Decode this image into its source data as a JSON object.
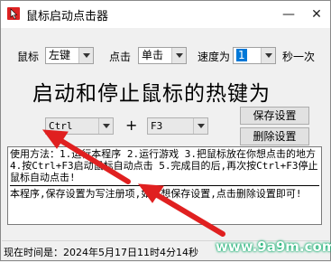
{
  "window": {
    "title": "鼠标启动点击器",
    "min_label": "—",
    "close_label": "✕"
  },
  "mouse_row": {
    "mouse_label": "鼠标",
    "button_value": "左键",
    "click_label": "点击",
    "click_mode_value": "单击",
    "speed_label": "速度为",
    "speed_value": "1",
    "unit_label": "秒一次"
  },
  "headline": "启动和停止鼠标的热键为",
  "hotkey": {
    "modifier_value": "Ctrl",
    "plus": "+",
    "key_value": "F3"
  },
  "buttons": {
    "save": "保存设置",
    "delete": "删除设置"
  },
  "instructions": {
    "p1": "使用方法：1.运行本程序 2.运行游戏 3.把鼠标放在你想点击的地方 4.按Ctrl+F3启动鼠标自动点击 5.完成目的后,再次按Ctrl+F3停止鼠标自动点击!",
    "p2": "本程序,保存设置为写注册项,如不想保存设置,点击删除设置即可!"
  },
  "status": "现在时间是：2024年5月17日11时4分14秒",
  "watermark": "www.9a9m.com",
  "colors": {
    "annotation_arrow": "#e02020",
    "selection": "#0078d7"
  }
}
